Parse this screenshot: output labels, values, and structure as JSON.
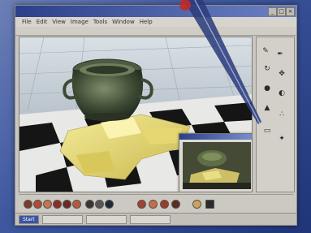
{
  "window": {
    "title": "",
    "menu": [
      "File",
      "Edit",
      "View",
      "Image",
      "Tools",
      "Window",
      "Help"
    ],
    "controls": [
      "minimize",
      "maximize",
      "close"
    ]
  },
  "viewport": {
    "object": "vase-icon",
    "floor": "checkerboard"
  },
  "inset": {
    "title": "",
    "preview": "render-preview"
  },
  "tools": [
    {
      "icon": "brush-icon",
      "glyph": "✎"
    },
    {
      "icon": "pen-icon",
      "glyph": "✒"
    },
    {
      "icon": "rotate-icon",
      "glyph": "↻"
    },
    {
      "icon": "move-icon",
      "glyph": "✥"
    },
    {
      "icon": "sphere-icon",
      "glyph": "●"
    },
    {
      "icon": "lathe-icon",
      "glyph": "◐"
    },
    {
      "icon": "extrude-icon",
      "glyph": "▲"
    },
    {
      "icon": "spray-icon",
      "glyph": "∴"
    },
    {
      "icon": "eraser-icon",
      "glyph": "▭"
    },
    {
      "icon": "light-icon",
      "glyph": "✦"
    }
  ],
  "palette": {
    "colors": [
      "#7a3b2a",
      "#b04a34",
      "#c2764e",
      "#8e2f23",
      "#6a2a24",
      "#b7583e",
      "#3a3636",
      "#5a5454",
      "#1c2a3a",
      "#a0422f",
      "#c96a4a",
      "#9b3c2c",
      "#5c2b22",
      "#d1a05a",
      "#2b2b2b"
    ]
  },
  "status": {
    "items": [
      "Start",
      "",
      "",
      ""
    ]
  }
}
